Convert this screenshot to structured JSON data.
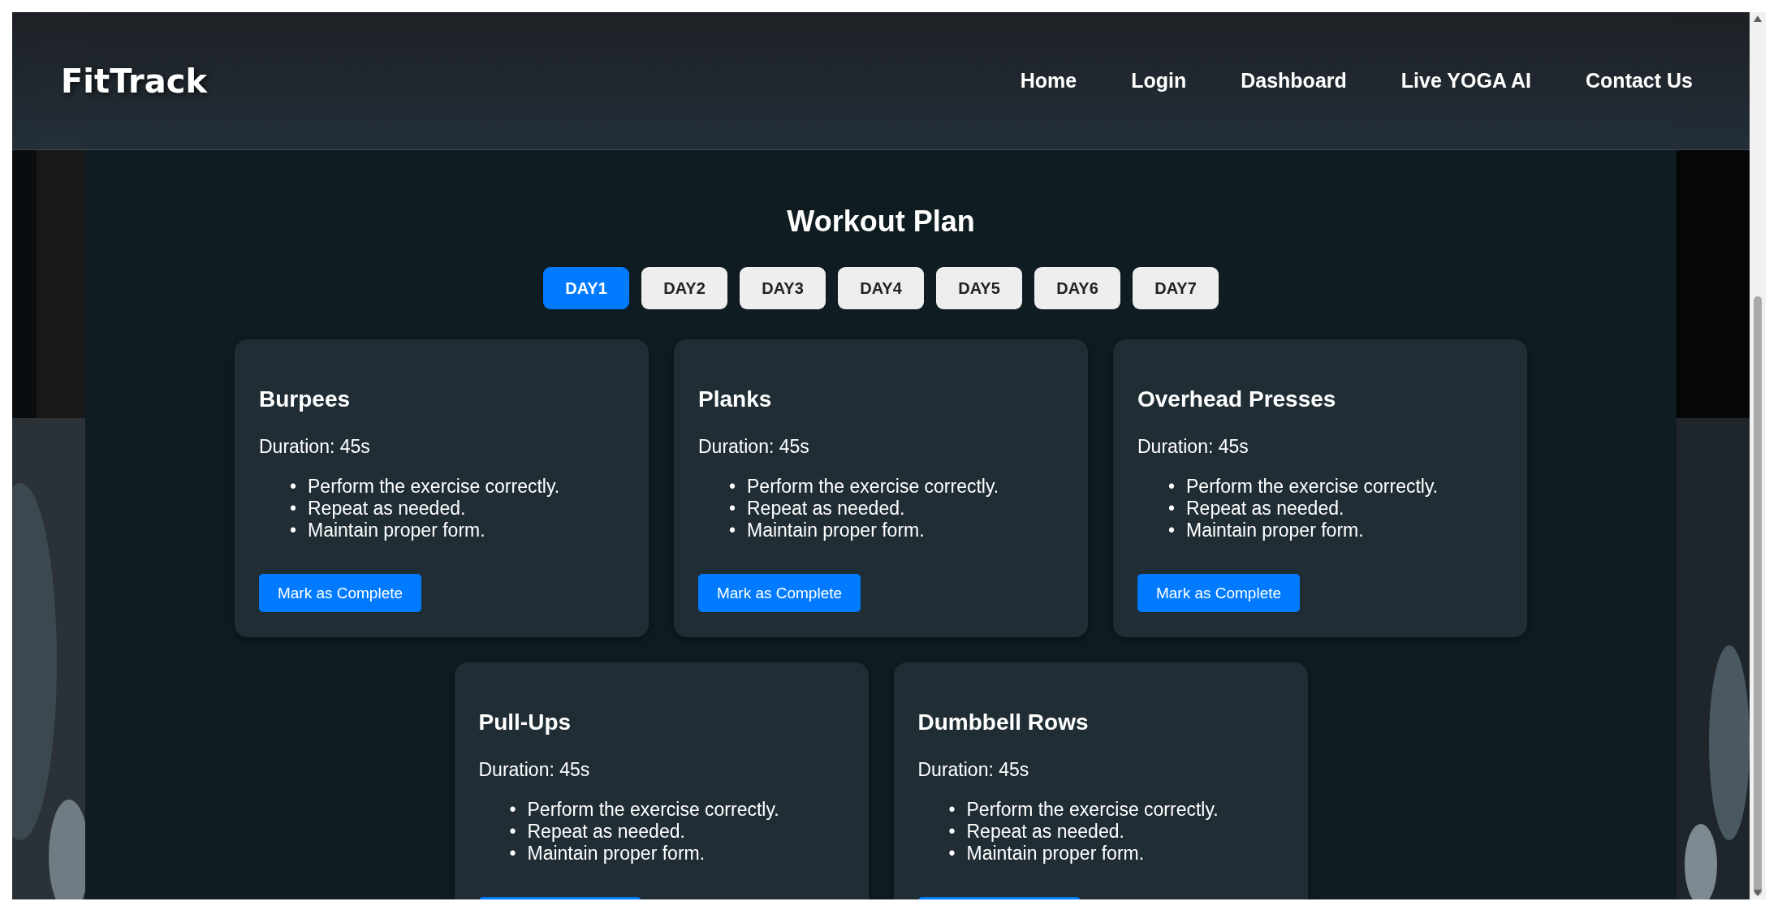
{
  "brand": "FitTrack",
  "nav": [
    {
      "label": "Home"
    },
    {
      "label": "Login"
    },
    {
      "label": "Dashboard"
    },
    {
      "label": "Live YOGA AI"
    },
    {
      "label": "Contact Us"
    }
  ],
  "title": "Workout Plan",
  "days": [
    {
      "label": "DAY1",
      "selected": true
    },
    {
      "label": "DAY2",
      "selected": false
    },
    {
      "label": "DAY3",
      "selected": false
    },
    {
      "label": "DAY4",
      "selected": false
    },
    {
      "label": "DAY5",
      "selected": false
    },
    {
      "label": "DAY6",
      "selected": false
    },
    {
      "label": "DAY7",
      "selected": false
    }
  ],
  "exercises": [
    {
      "bullet": "•",
      "name": "Burpees",
      "duration": "Duration: 45s",
      "steps": [
        "Perform the exercise correctly.",
        "Repeat as needed.",
        "Maintain proper form."
      ],
      "button": "Mark as Complete"
    },
    {
      "bullet": "•",
      "name": "Planks",
      "duration": "Duration: 45s",
      "steps": [
        "Perform the exercise correctly.",
        "Repeat as needed.",
        "Maintain proper form."
      ],
      "button": "Mark as Complete"
    },
    {
      "bullet": "•",
      "name": "Overhead Presses",
      "duration": "Duration: 45s",
      "steps": [
        "Perform the exercise correctly.",
        "Repeat as needed.",
        "Maintain proper form."
      ],
      "button": "Mark as Complete"
    },
    {
      "bullet": "•",
      "name": "Pull-Ups",
      "duration": "Duration: 45s",
      "steps": [
        "Perform the exercise correctly.",
        "Repeat as needed.",
        "Maintain proper form."
      ],
      "button_cut_off": true
    },
    {
      "bullet": "•",
      "name": "Dumbbell Rows",
      "duration": "Duration: 45s",
      "steps": [
        "Perform the exercise correctly.",
        "Repeat as needed.",
        "Maintain proper form."
      ],
      "button_cut_off": true
    }
  ]
}
